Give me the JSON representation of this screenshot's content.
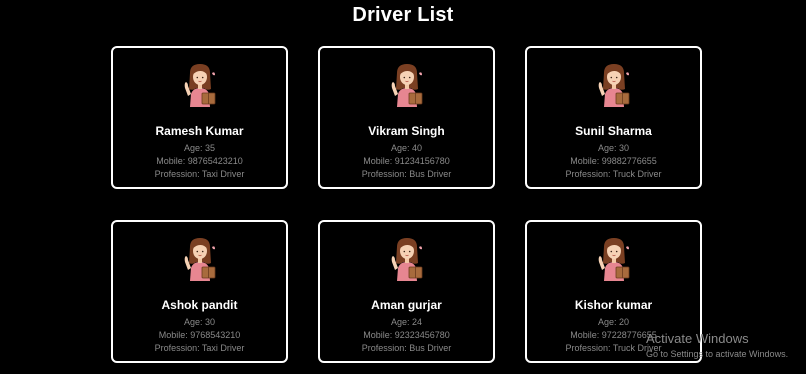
{
  "page": {
    "title": "Driver List"
  },
  "drivers": [
    {
      "name": "Ramesh Kumar",
      "age": "Age: 35",
      "mobile": "Mobile: 98765423210",
      "profession": "Profession: Taxi Driver"
    },
    {
      "name": "Vikram Singh",
      "age": "Age: 40",
      "mobile": "Mobile: 91234156780",
      "profession": "Profession: Bus Driver"
    },
    {
      "name": "Sunil Sharma",
      "age": "Age: 30",
      "mobile": "Mobile: 99882776655",
      "profession": "Profession: Truck Driver"
    },
    {
      "name": "Ashok pandit",
      "age": "Age: 30",
      "mobile": "Mobile: 9768543210",
      "profession": "Profession: Taxi Driver"
    },
    {
      "name": "Aman gurjar",
      "age": "Age: 24",
      "mobile": "Mobile: 92323456780",
      "profession": "Profession: Bus Driver"
    },
    {
      "name": "Kishor kumar",
      "age": "Age: 20",
      "mobile": "Mobile: 97228776655",
      "profession": "Profession: Truck Driver"
    }
  ],
  "avatar_icon": "driver-avatar-icon",
  "watermark": {
    "title": "Activate Windows",
    "subtitle": "Go to Settings to activate Windows."
  }
}
